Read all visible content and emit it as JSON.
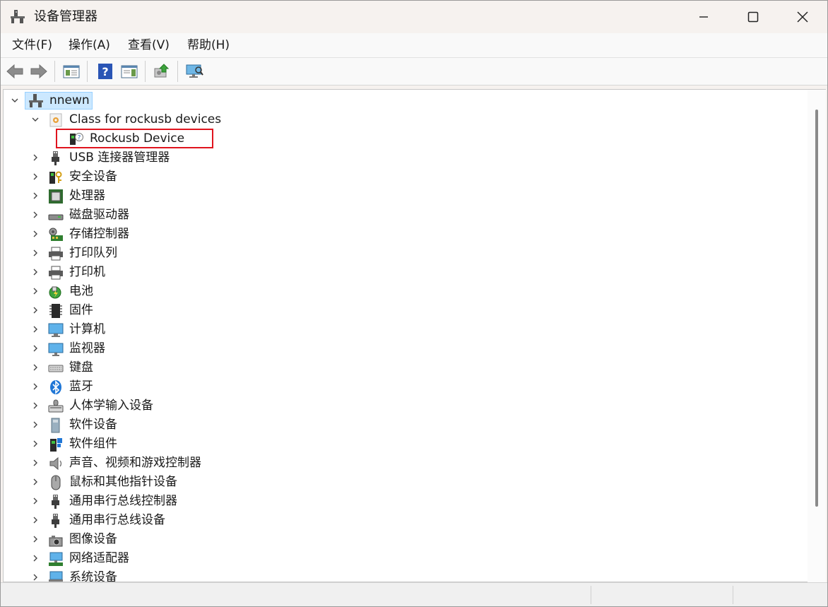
{
  "window": {
    "title": "设备管理器",
    "controls": {
      "minimize": "minimize",
      "maximize": "maximize",
      "close": "close"
    }
  },
  "menu": [
    {
      "label": "文件(F)"
    },
    {
      "label": "操作(A)"
    },
    {
      "label": "查看(V)"
    },
    {
      "label": "帮助(H)"
    }
  ],
  "toolbar": {
    "icons": [
      "back-arrow-icon",
      "forward-arrow-icon",
      "properties-pane-icon",
      "help-icon",
      "action-pane-icon",
      "update-driver-icon",
      "scan-hardware-icon"
    ]
  },
  "tree": {
    "root": {
      "label": "nnewn",
      "icon": "computer-network-icon",
      "expanded": true,
      "selected": true
    },
    "children": [
      {
        "label": "Class for rockusb devices",
        "icon": "device-class-icon",
        "expanded": true,
        "children": [
          {
            "label": "Rockusb Device",
            "icon": "unknown-device-icon",
            "highlighted": true,
            "highlight_color": "#e0141e"
          }
        ]
      },
      {
        "label": "USB 连接器管理器",
        "icon": "usb-connector-icon"
      },
      {
        "label": "安全设备",
        "icon": "security-device-icon"
      },
      {
        "label": "处理器",
        "icon": "processor-icon"
      },
      {
        "label": "磁盘驱动器",
        "icon": "disk-drive-icon"
      },
      {
        "label": "存储控制器",
        "icon": "storage-controller-icon"
      },
      {
        "label": "打印队列",
        "icon": "print-queue-icon"
      },
      {
        "label": "打印机",
        "icon": "printer-icon"
      },
      {
        "label": "电池",
        "icon": "battery-icon"
      },
      {
        "label": "固件",
        "icon": "firmware-icon"
      },
      {
        "label": "计算机",
        "icon": "computer-icon"
      },
      {
        "label": "监视器",
        "icon": "monitor-icon"
      },
      {
        "label": "键盘",
        "icon": "keyboard-icon"
      },
      {
        "label": "蓝牙",
        "icon": "bluetooth-icon"
      },
      {
        "label": "人体学输入设备",
        "icon": "hid-icon"
      },
      {
        "label": "软件设备",
        "icon": "software-device-icon"
      },
      {
        "label": "软件组件",
        "icon": "software-component-icon"
      },
      {
        "label": "声音、视频和游戏控制器",
        "icon": "audio-icon"
      },
      {
        "label": "鼠标和其他指针设备",
        "icon": "mouse-icon"
      },
      {
        "label": "通用串行总线控制器",
        "icon": "usb-controller-icon"
      },
      {
        "label": "通用串行总线设备",
        "icon": "usb-device-icon"
      },
      {
        "label": "图像设备",
        "icon": "imaging-device-icon"
      },
      {
        "label": "网络适配器",
        "icon": "network-adapter-icon"
      },
      {
        "label": "系统设备",
        "icon": "system-device-icon"
      }
    ]
  },
  "colors": {
    "titlebar_bg": "#f6f2ef",
    "selection_bg": "#cce8ff",
    "highlight_box": "#e0141e"
  }
}
